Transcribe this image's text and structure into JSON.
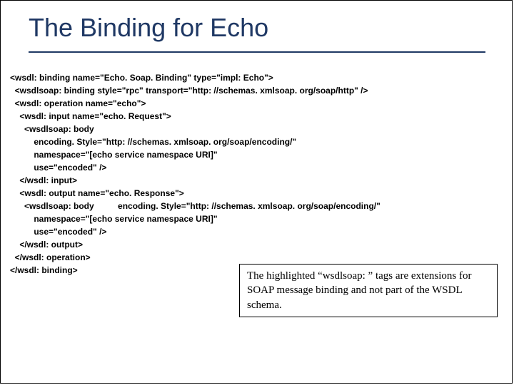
{
  "title": "The Binding for Echo",
  "code": {
    "l01": "<wsdl: binding name=\"Echo. Soap. Binding\" type=\"impl: Echo\">",
    "l02": "  <wsdlsoap: binding style=\"rpc\" transport=\"http: //schemas. xmlsoap. org/soap/http\" />",
    "l03": "  <wsdl: operation name=\"echo\">",
    "l04": "    <wsdl: input name=\"echo. Request\">",
    "l05": "      <wsdlsoap: body",
    "l06": "          encoding. Style=\"http: //schemas. xmlsoap. org/soap/encoding/\"",
    "l07": "          namespace=\"[echo service namespace URI]\"",
    "l08": "          use=\"encoded\" />",
    "l09": "    </wsdl: input>",
    "l10": "    <wsdl: output name=\"echo. Response\">",
    "l11": "      <wsdlsoap: body          encoding. Style=\"http: //schemas. xmlsoap. org/soap/encoding/\"",
    "l12": "          namespace=\"[echo service namespace URI]\"",
    "l13": "          use=\"encoded\" />",
    "l14": "    </wsdl: output>",
    "l15": "  </wsdl: operation>",
    "l16": "</wsdl: binding>"
  },
  "callout": "The highlighted “wsdlsoap: ” tags are extensions for SOAP message binding and not part of the WSDL schema."
}
